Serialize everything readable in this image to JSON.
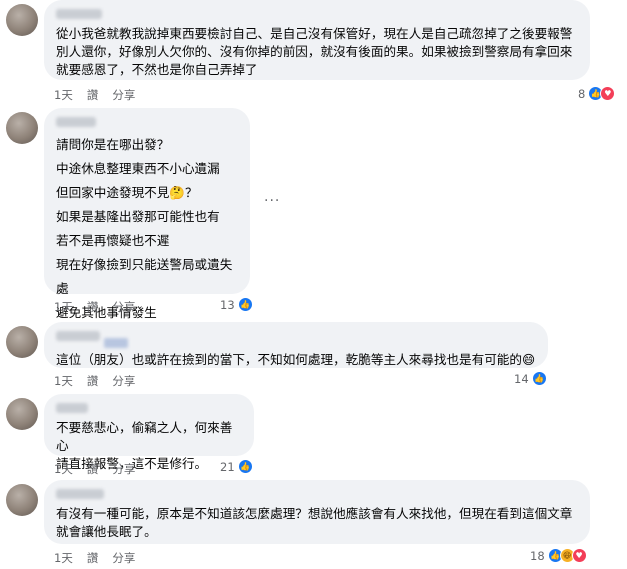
{
  "comments": [
    {
      "text": "從小我爸就教我說掉東西要檢討自己、是自己沒有保管好，現在人是自己疏忽掉了之後要報警別人還你，好像別人欠你的、沒有你掉的前因，就沒有後面的果。如果被撿到警察局有拿回來就要感恩了，不然也是你自己弄掉了",
      "time": "1天",
      "like": "讚",
      "reply": "分享",
      "count": "8",
      "reactions": [
        "like-icon",
        "love-icon"
      ]
    },
    {
      "lines": [
        "請問你是在哪出發？",
        "中途休息整理東西不小心遺漏",
        "但回家中途發現不見🤔？",
        "如果是基隆出發那可能性也有",
        "若不是再懷疑也不遲",
        "現在好像撿到只能送警局或遺失處",
        "避免其他事情發生"
      ],
      "time": "1天",
      "like": "讚",
      "reply": "分享",
      "count": "13",
      "reactions": [
        "like-icon"
      ],
      "more": "···"
    },
    {
      "text": "這位（朋友）也或許在撿到的當下，不知如何處理，乾脆等主人來尋找也是有可能的😄",
      "time": "1天",
      "like": "讚",
      "reply": "分享",
      "count": "14",
      "reactions": [
        "like-icon"
      ]
    },
    {
      "text": "不要慈悲心，偷竊之人，何來善心\n請直接報警，這不是修行。",
      "time": "1天",
      "like": "讚",
      "reply": "分享",
      "count": "21",
      "reactions": [
        "like-icon"
      ]
    },
    {
      "text": "有沒有一種可能，原本是不知道該怎麼處理？想說他應該會有人來找他，但現在看到這個文章就會讓他長眠了。",
      "time": "1天",
      "like": "讚",
      "reply": "分享",
      "count": "18",
      "reactions": [
        "like-icon",
        "haha-icon",
        "love-icon"
      ]
    }
  ],
  "colors": {
    "bubble": "#f0f2f5",
    "meta": "#65676b",
    "like": "#1877f2",
    "love": "#f33e58",
    "haha": "#f7b125"
  }
}
